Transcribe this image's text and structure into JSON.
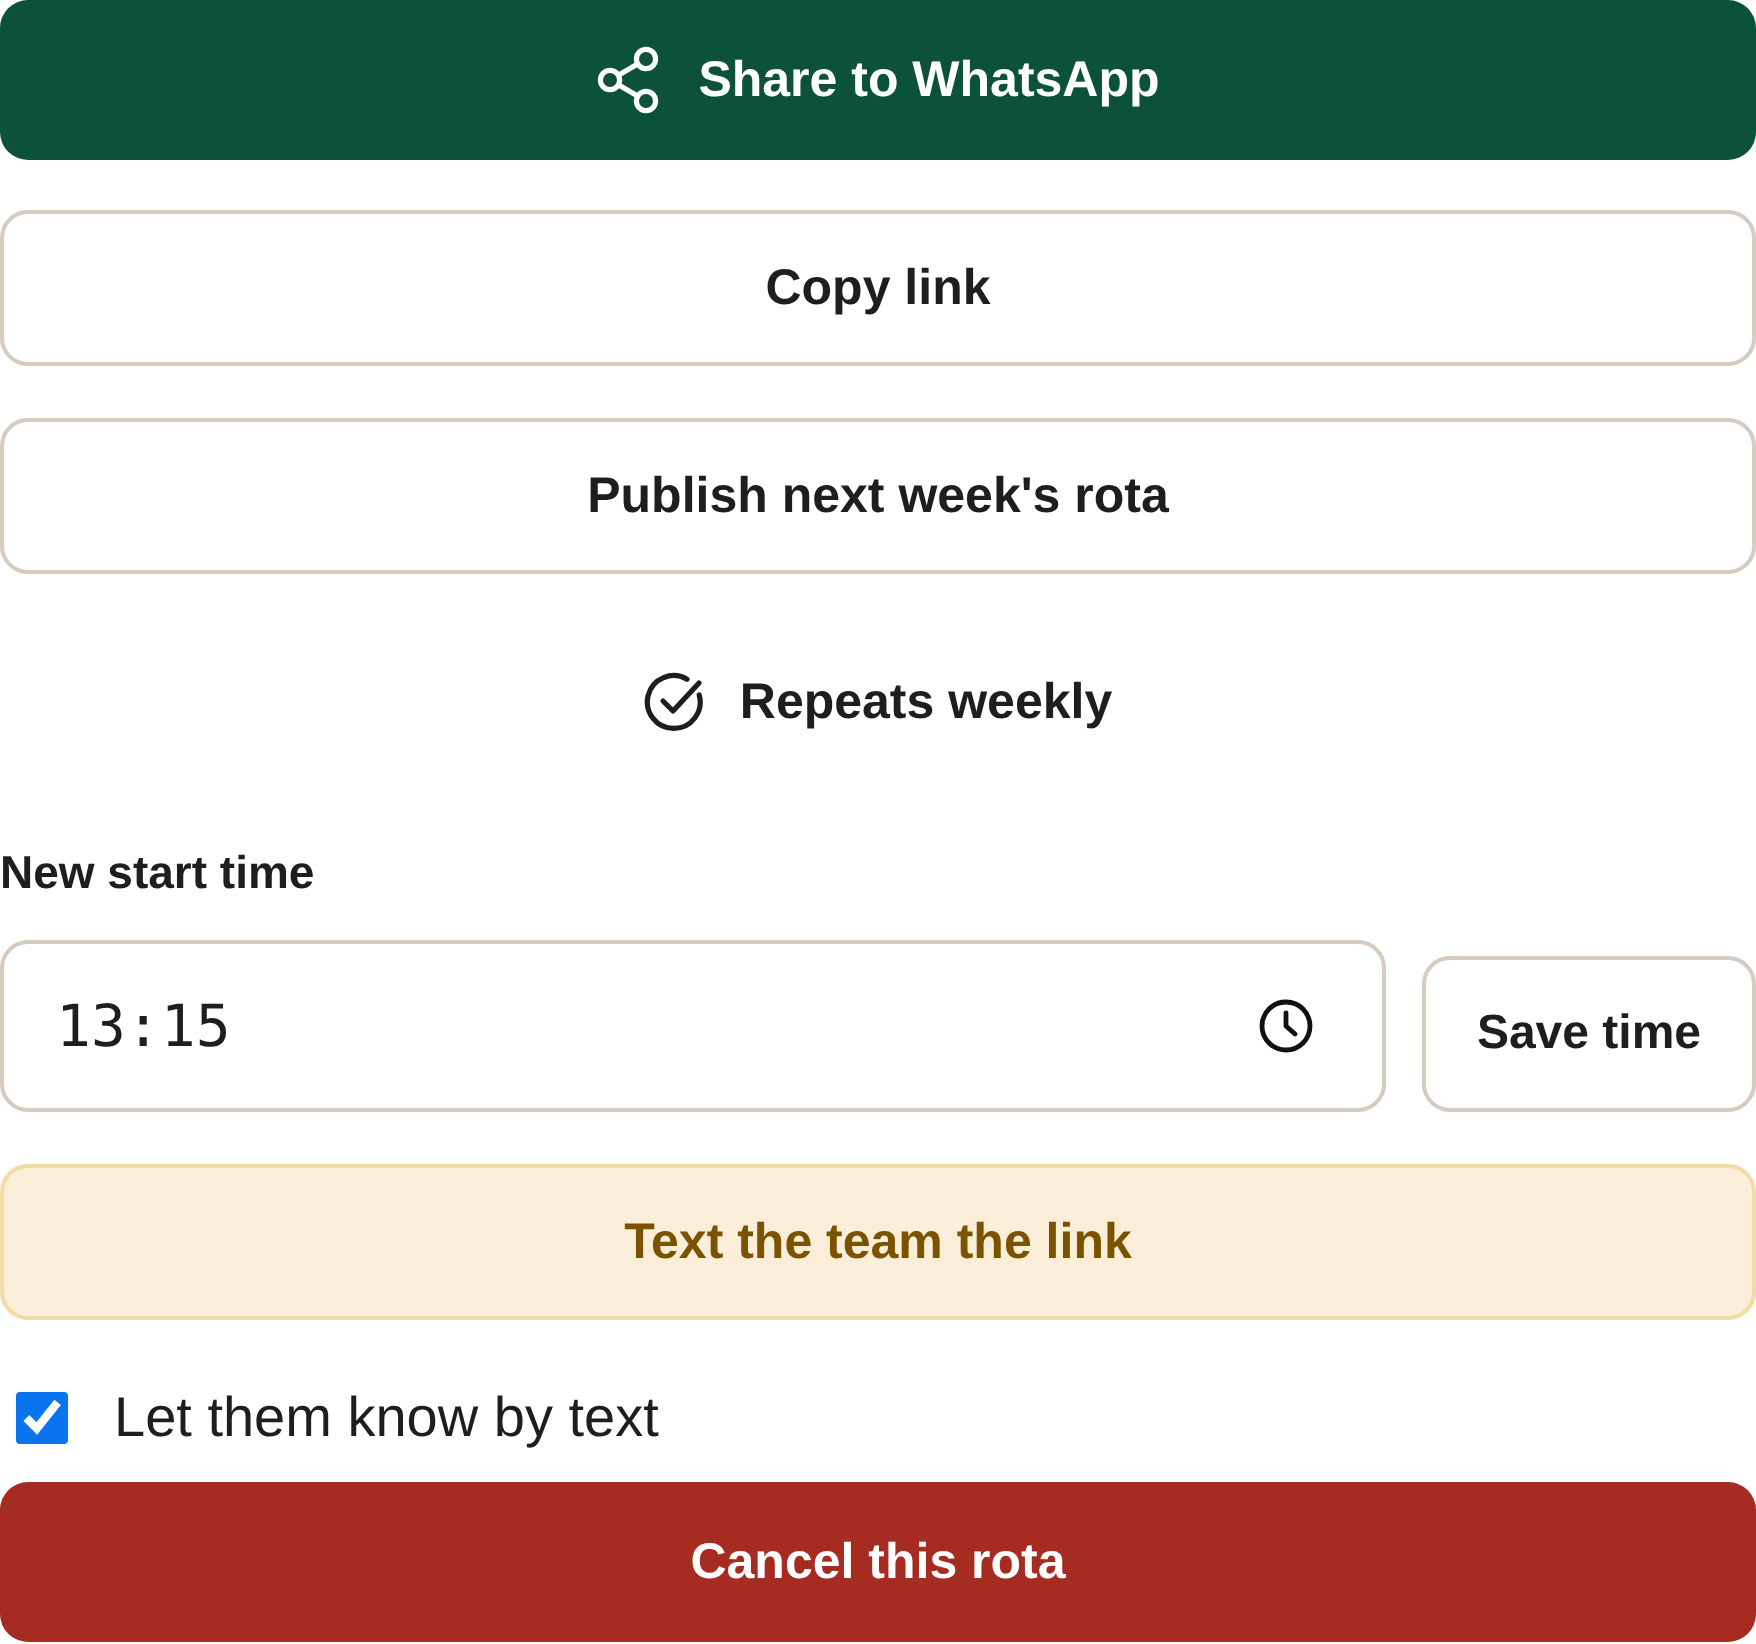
{
  "share_button": {
    "label": "Share to WhatsApp"
  },
  "copy_link_button": {
    "label": "Copy link"
  },
  "publish_button": {
    "label": "Publish next week's rota"
  },
  "repeat_status": {
    "label": "Repeats weekly"
  },
  "start_time": {
    "label": "New start time",
    "value": "13:15",
    "save_button": "Save time"
  },
  "text_team_button": {
    "label": "Text the team the link"
  },
  "notify_by_text": {
    "label": "Let them know by text",
    "checked": true
  },
  "cancel_button": {
    "label": "Cancel this rota"
  }
}
